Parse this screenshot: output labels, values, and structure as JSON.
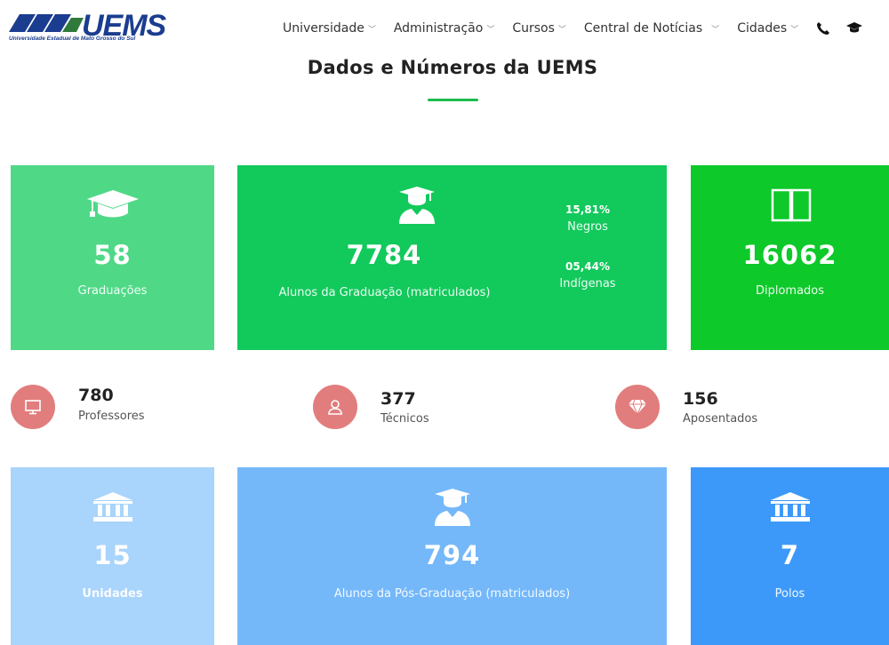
{
  "header": {
    "logo_text": "UEMS",
    "logo_subtitle": "Universidade Estadual de Mato Grosso do Sul",
    "nav": [
      {
        "label": "Universidade"
      },
      {
        "label": "Administração"
      },
      {
        "label": "Cursos"
      },
      {
        "label": "Central de Notícias"
      },
      {
        "label": "Cidades"
      }
    ]
  },
  "main": {
    "title": "Dados e Números da UEMS"
  },
  "top_cards": [
    {
      "icon": "graduation-cap-icon",
      "value": "58",
      "label": "Graduações"
    },
    {
      "icon": "student-icon",
      "value": "7784",
      "label": "Alunos da Graduação (matriculados)",
      "extra": [
        {
          "value": "15,81%",
          "label": "Negros"
        },
        {
          "value": "05,44%",
          "label": "Indígenas"
        }
      ]
    },
    {
      "icon": "book-icon",
      "value": "16062",
      "label": "Diplomados"
    }
  ],
  "stats": [
    {
      "icon": "monitor-icon",
      "value": "780",
      "label": "Professores"
    },
    {
      "icon": "user-icon",
      "value": "377",
      "label": "Técnicos"
    },
    {
      "icon": "diamond-icon",
      "value": "156",
      "label": "Aposentados"
    }
  ],
  "bottom_cards": [
    {
      "icon": "institution-icon",
      "value": "15",
      "label": "Unidades"
    },
    {
      "icon": "student-icon",
      "value": "794",
      "label": "Alunos da Pós-Graduação (matriculados)"
    },
    {
      "icon": "institution-icon",
      "value": "7",
      "label": "Polos"
    }
  ],
  "colors": {
    "accent": "#1dbb4e",
    "card_green_light": "#4fd987",
    "card_green": "#12c95c",
    "card_green_strong": "#0dc929",
    "card_blue_light": "#a9d4fb",
    "card_blue": "#74b8fa",
    "card_blue_strong": "#3c99f9",
    "stat_circle": "#e27d7d",
    "logo": "#1a3d8f"
  }
}
